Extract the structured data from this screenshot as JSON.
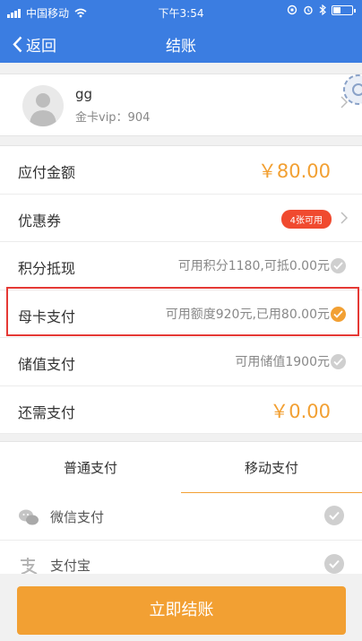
{
  "status": {
    "carrier": "中国移动",
    "time": "下午3:54"
  },
  "nav": {
    "back_label": "返回",
    "title": "结账"
  },
  "user": {
    "name": "gg",
    "vip": "金卡vip：904"
  },
  "rows": [
    {
      "label": "应付金额",
      "amount": "￥80.00"
    },
    {
      "label": "优惠券",
      "badge": "4张可用"
    },
    {
      "label": "积分抵现",
      "value": "可用积分1180,可抵0.00元",
      "checked": false
    },
    {
      "label": "母卡支付",
      "value": "可用额度920元,已用80.00元",
      "checked": true
    },
    {
      "label": "储值支付",
      "value": "可用储值1900元",
      "checked": false
    },
    {
      "label": "还需支付",
      "amount": "￥0.00"
    }
  ],
  "tabs": {
    "normal": "普通支付",
    "mobile": "移动支付"
  },
  "payments": [
    {
      "label": "微信支付",
      "icon": "wechat-icon"
    },
    {
      "label": "支付宝",
      "icon": "alipay-icon"
    }
  ],
  "footer": {
    "button": "立即结账"
  },
  "colors": {
    "brand": "#3b7de1",
    "accent": "#f2a033",
    "badge": "#f04a2f",
    "highlight": "#e53935"
  }
}
